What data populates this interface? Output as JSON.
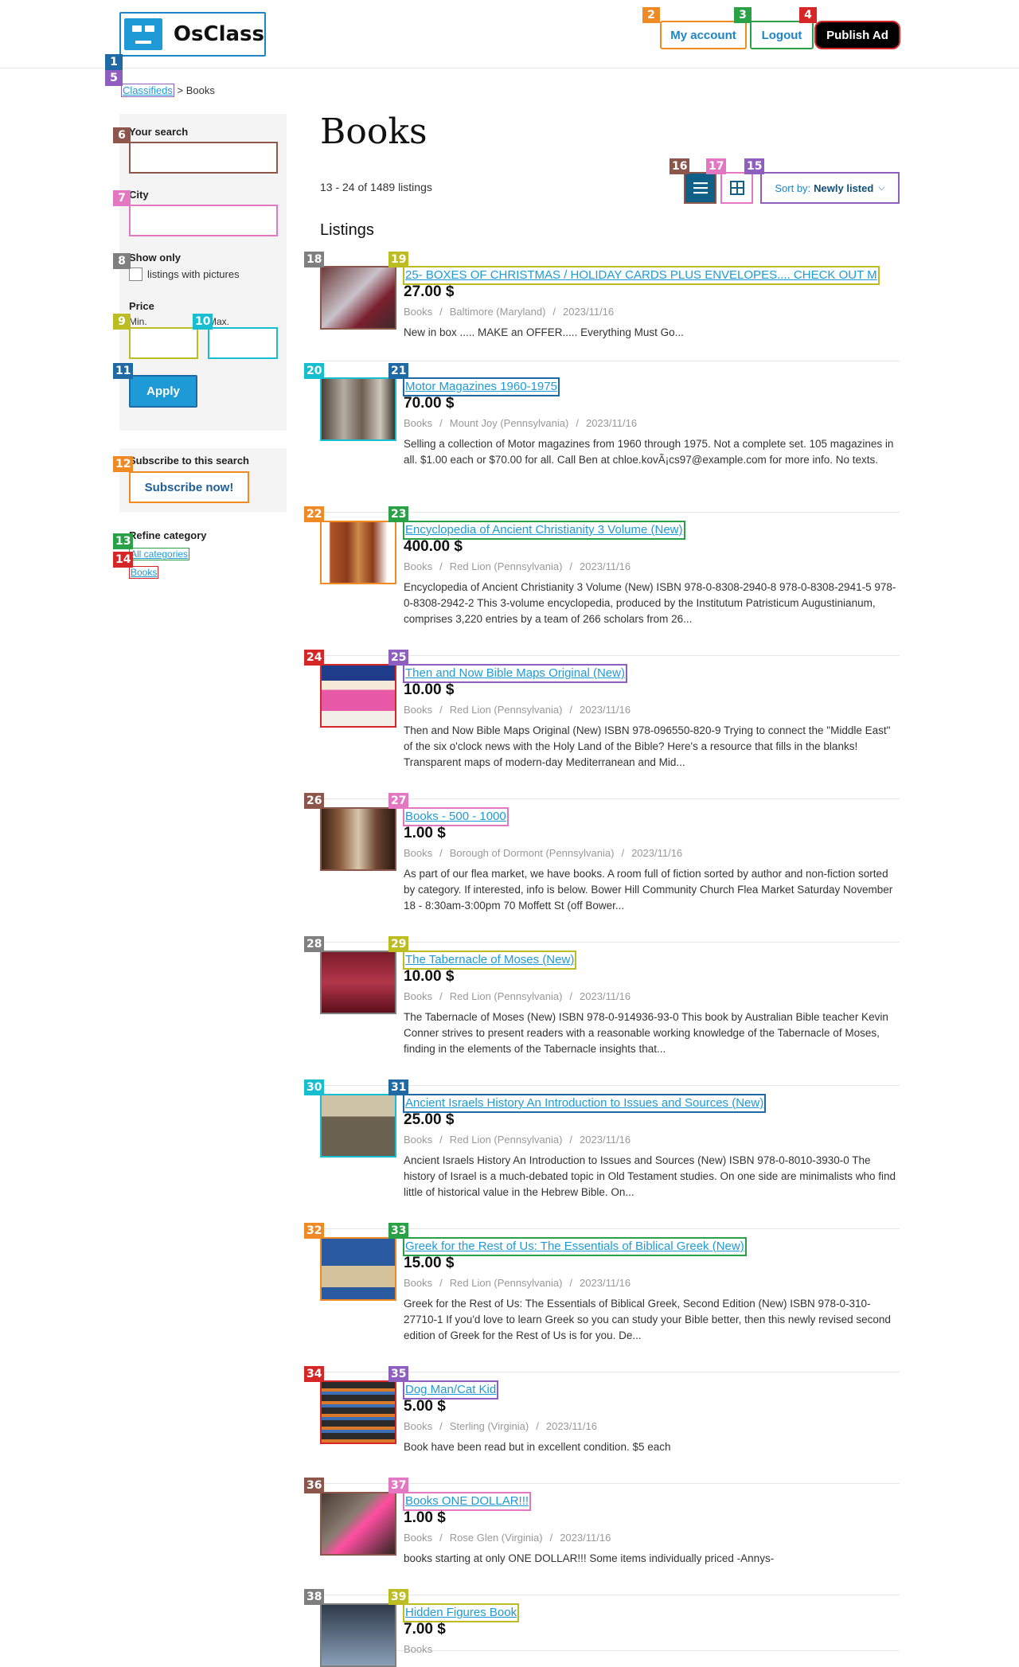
{
  "header": {
    "logo_text": "OsClass",
    "my_account": "My account",
    "logout": "Logout",
    "publish": "Publish Ad"
  },
  "breadcrumb": {
    "root": "Classifieds",
    "sep": ">",
    "current": "Books"
  },
  "sidebar": {
    "your_search": "Your search",
    "city": "City",
    "show_only": "Show only",
    "pictures_label": "listings with pictures",
    "price": "Price",
    "min": "Min.",
    "max": "Max.",
    "apply": "Apply",
    "subscribe_title": "Subscribe to this search",
    "subscribe_btn": "Subscribe now!",
    "refine_title": "Refine category",
    "cat_all": "All categories",
    "cat_books": "Books"
  },
  "main": {
    "title": "Books",
    "count": "13 - 24 of 1489 listings",
    "sort_prefix": "Sort by:",
    "sort_value": "Newly listed",
    "listings_heading": "Listings"
  },
  "listings": [
    {
      "title": "25- BOXES OF CHRISTMAS / HOLIDAY CARDS PLUS ENVELOPES.... CHECK OUT M",
      "price": "27.00 $",
      "category": "Books",
      "location": "Baltimore (Maryland)",
      "date": "2023/11/16",
      "desc": "New in box ..... MAKE an OFFER..... Everything Must Go..."
    },
    {
      "title": "Motor Magazines 1960-1975",
      "price": "70.00 $",
      "category": "Books",
      "location": "Mount Joy (Pennsylvania)",
      "date": "2023/11/16",
      "desc": "Selling a collection of Motor magazines from 1960 through 1975. Not a complete set. 105 magazines in all. $1.00 each or $70.00 for all. Call Ben at chloe.kovÃ¡cs97@example.com for more info. No texts."
    },
    {
      "title": "Encyclopedia of Ancient Christianity 3 Volume (New)",
      "price": "400.00 $",
      "category": "Books",
      "location": "Red Lion (Pennsylvania)",
      "date": "2023/11/16",
      "desc": "Encyclopedia of Ancient Christianity 3 Volume (New) ISBN 978-0-8308-2940-8 978-0-8308-2941-5 978-0-8308-2942-2 This 3-volume encyclopedia, produced by the Institutum Patristicum Augustinianum, comprises 3,220 entries by a team of 266 scholars from 26..."
    },
    {
      "title": "Then and Now Bible Maps Original (New)",
      "price": "10.00 $",
      "category": "Books",
      "location": "Red Lion (Pennsylvania)",
      "date": "2023/11/16",
      "desc": "Then and Now Bible Maps Original (New) ISBN 978-096550-820-9 Trying to connect the \"Middle East\" of the six o'clock news with the Holy Land of the Bible? Here's a resource that fills in the blanks! Transparent maps of modern-day Mediterranean and Mid..."
    },
    {
      "title": "Books - 500 - 1000",
      "price": "1.00 $",
      "category": "Books",
      "location": "Borough of Dormont (Pennsylvania)",
      "date": "2023/11/16",
      "desc": "As part of our flea market, we have books. A room full of fiction sorted by author and non-fiction sorted by category. If interested, info is below. Bower Hill Community Church Flea Market Saturday November 18 - 8:30am-3:00pm 70 Moffett St (off Bower..."
    },
    {
      "title": "The Tabernacle of Moses (New)",
      "price": "10.00 $",
      "category": "Books",
      "location": "Red Lion (Pennsylvania)",
      "date": "2023/11/16",
      "desc": "The Tabernacle of Moses (New) ISBN 978-0-914936-93-0 This book by Australian Bible teacher Kevin Conner strives to present readers with a reasonable working knowledge of the Tabernacle of Moses, finding in the elements of the Tabernacle insights that..."
    },
    {
      "title": "Ancient Israels History An Introduction to Issues and Sources (New)",
      "price": "25.00 $",
      "category": "Books",
      "location": "Red Lion (Pennsylvania)",
      "date": "2023/11/16",
      "desc": "Ancient Israels History An Introduction to Issues and Sources (New) ISBN 978-0-8010-3930-0 The history of Israel is a much-debated topic in Old Testament studies. On one side are minimalists who find little of historical value in the Hebrew Bible. On..."
    },
    {
      "title": "Greek for the Rest of Us: The Essentials of Biblical Greek (New)",
      "price": "15.00 $",
      "category": "Books",
      "location": "Red Lion (Pennsylvania)",
      "date": "2023/11/16",
      "desc": "Greek for the Rest of Us: The Essentials of Biblical Greek, Second Edition (New) ISBN 978-0-310-27710-1 If you'd love to learn Greek so you can study your Bible better, then this newly revised second edition of Greek for the Rest of Us is for you. De..."
    },
    {
      "title": "Dog Man/Cat Kid",
      "price": "5.00 $",
      "category": "Books",
      "location": "Sterling (Virginia)",
      "date": "2023/11/16",
      "desc": "Book have been read but in excellent condition. $5 each"
    },
    {
      "title": "Books ONE DOLLAR!!!",
      "price": "1.00 $",
      "category": "Books",
      "location": "Rose Glen (Virginia)",
      "date": "2023/11/16",
      "desc": "books starting at only ONE DOLLAR!!! Some items individually priced -Annys-"
    },
    {
      "title": "Hidden Figures Book",
      "price": "7.00 $",
      "category": "Books",
      "location": "",
      "date": "",
      "desc": ""
    }
  ],
  "badges": [
    "1",
    "2",
    "3",
    "4",
    "5",
    "6",
    "7",
    "8",
    "9",
    "10",
    "11",
    "12",
    "13",
    "14",
    "15",
    "16",
    "17",
    "18",
    "19",
    "20",
    "21",
    "22",
    "23",
    "24",
    "25",
    "26",
    "27",
    "28",
    "29",
    "30",
    "31",
    "32",
    "33",
    "34",
    "35",
    "36",
    "37",
    "38",
    "39"
  ],
  "colors": {
    "link": "#1e9bd7",
    "apply_bg": "#1e9bd7",
    "view_active": "#0f5f86",
    "publish_bg": "#000000"
  }
}
